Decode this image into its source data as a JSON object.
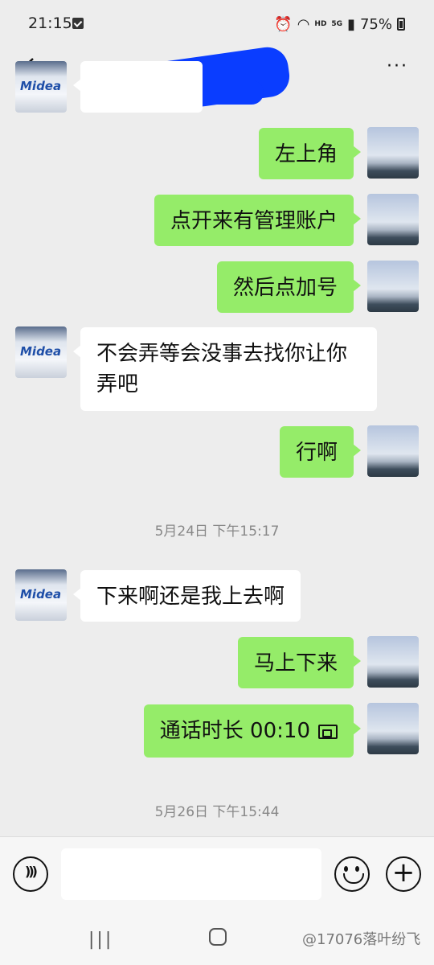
{
  "status_bar": {
    "time": "21:15",
    "network": "5G",
    "hd": "HD",
    "battery": "75%"
  },
  "nav": {
    "back_icon": "chevron-left-icon",
    "more_icon": "more-dots-icon",
    "more_label": "···"
  },
  "messages": [
    {
      "side": "mine",
      "text": "左上角"
    },
    {
      "side": "mine",
      "text": "点开来有管理账户"
    },
    {
      "side": "mine",
      "text": "然后点加号"
    },
    {
      "side": "theirs",
      "text": "不会弄等会没事去找你让你弄吧"
    },
    {
      "side": "mine",
      "text": "行啊"
    },
    {
      "side": "theirs",
      "text": "下来啊还是我上去啊"
    },
    {
      "side": "mine",
      "text": "马上下来"
    },
    {
      "side": "mine",
      "text": "通话时长 00:10"
    }
  ],
  "timestamps": [
    "5月24日 下午15:17",
    "5月26日 下午15:44"
  ],
  "avatar_other": {
    "logo_text": "Midea"
  },
  "input_bar": {
    "voice_icon": "voice-icon",
    "emoji_icon": "emoji-icon",
    "plus_label": "+"
  },
  "system_nav": {
    "recent_label": "|||",
    "watermark": "@17076落叶纷飞"
  },
  "colors": {
    "mine_bubble": "#95ec69",
    "theirs_bubble": "#ffffff",
    "background": "#ededed",
    "redaction": "#0a3dff"
  }
}
